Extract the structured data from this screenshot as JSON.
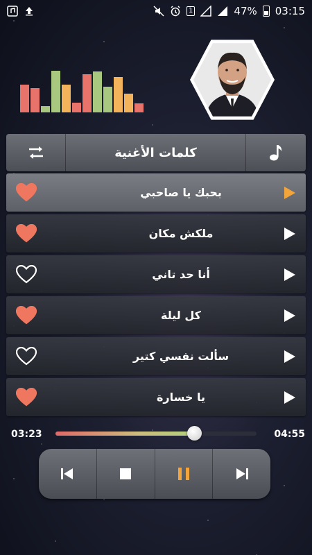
{
  "status_bar": {
    "battery": "47%",
    "time": "03:15",
    "sim_badge": "1"
  },
  "equalizer": {
    "levels": [
      0.62,
      0.55,
      0.14,
      0.94,
      0.62,
      0.22,
      0.86,
      0.92,
      0.58,
      0.8,
      0.42,
      0.2
    ],
    "colors": [
      "#e8736a",
      "#e8736a",
      "#a8c87f",
      "#a8c87f",
      "#f3b35a",
      "#e8736a",
      "#e8736a",
      "#a8c87f",
      "#a8c87f",
      "#f3b35a",
      "#f3b35a",
      "#e8736a"
    ]
  },
  "header": {
    "title": "كلمات الأغنية",
    "repeat_icon": "shuffle-icon",
    "music_icon": "music-note-icon"
  },
  "songs": [
    {
      "title": "بحبك يا صاحبي",
      "favorite": true,
      "active": true
    },
    {
      "title": "ملكش مكان",
      "favorite": true,
      "active": false
    },
    {
      "title": "أنا حد تاني",
      "favorite": false,
      "active": false
    },
    {
      "title": "كل ليلة",
      "favorite": true,
      "active": false
    },
    {
      "title": "سألت نفسي كتير",
      "favorite": false,
      "active": false
    },
    {
      "title": "يا خسارة",
      "favorite": true,
      "active": false
    }
  ],
  "player": {
    "current_time": "03:23",
    "total_time": "04:55",
    "progress": 0.688
  },
  "colors": {
    "accent": "#f3a43a",
    "heart": "#f0775f",
    "white": "#ffffff"
  }
}
